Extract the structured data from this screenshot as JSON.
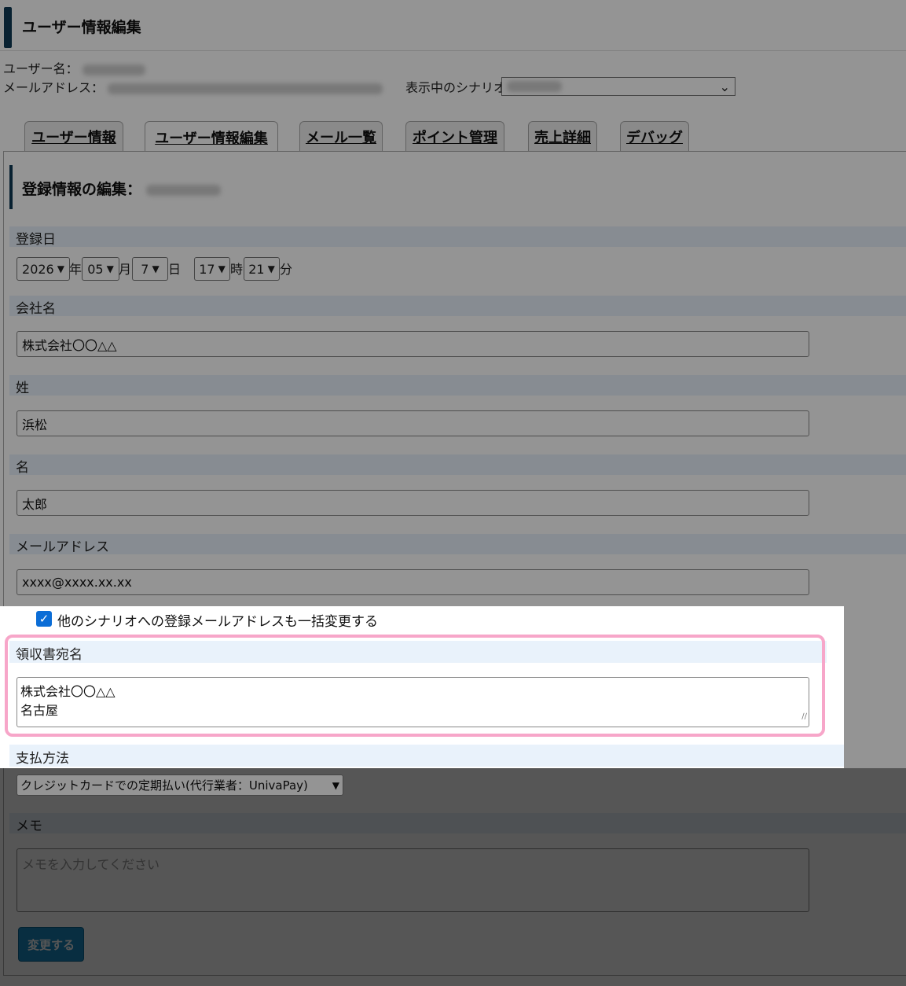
{
  "page_title": "ユーザー情報編集",
  "user": {
    "name_label": "ユーザー名：",
    "email_label": "メールアドレス：",
    "scenario_label": "表示中のシナリオ"
  },
  "tabs": [
    "ユーザー情報",
    "ユーザー情報編集",
    "メール一覧",
    "ポイント管理",
    "売上詳細",
    "デバッグ"
  ],
  "section_title": "登録情報の編集：",
  "form": {
    "registration_date_label": "登録日",
    "year": "2026",
    "year_unit": "年",
    "month": "05",
    "month_unit": "月",
    "day": "7",
    "day_unit": "日",
    "hour": "17",
    "hour_unit": "時",
    "minute": "21",
    "minute_unit": "分",
    "company_label": "会社名",
    "company_value": "株式会社〇〇△△",
    "last_name_label": "姓",
    "last_name_value": "浜松",
    "first_name_label": "名",
    "first_name_value": "太郎",
    "email_label": "メールアドレス",
    "email_value": "xxxx@xxxx.xx.xx",
    "bulk_change_label": "他のシナリオへの登録メールアドレスも一括変更する",
    "receipt_label": "領収書宛名",
    "receipt_line1": "株式会社〇〇△△",
    "receipt_line2": "名古屋",
    "payment_label": "支払方法",
    "payment_value": "クレジットカードでの定期払い(代行業者：UnivaPay)",
    "memo_label": "メモ",
    "memo_placeholder": "メモを入力してください",
    "submit_label": "変更する"
  }
}
